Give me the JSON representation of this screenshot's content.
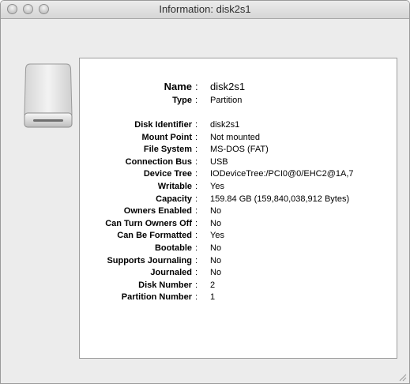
{
  "window": {
    "title": "Information: disk2s1"
  },
  "icons": {
    "drive": "external-drive-icon",
    "resize": "resize-grip-icon"
  },
  "info": {
    "name": {
      "label": "Name",
      "value": "disk2s1"
    },
    "type": {
      "label": "Type",
      "value": "Partition"
    },
    "properties": [
      {
        "label": "Disk Identifier",
        "value": "disk2s1"
      },
      {
        "label": "Mount Point",
        "value": "Not mounted"
      },
      {
        "label": "File System",
        "value": "MS-DOS (FAT)"
      },
      {
        "label": "Connection Bus",
        "value": "USB"
      },
      {
        "label": "Device Tree",
        "value": "IODeviceTree:/PCI0@0/EHC2@1A,7"
      },
      {
        "label": "Writable",
        "value": "Yes"
      },
      {
        "label": "Capacity",
        "value": "159.84 GB (159,840,038,912 Bytes)"
      },
      {
        "label": "Owners Enabled",
        "value": "No"
      },
      {
        "label": "Can Turn Owners Off",
        "value": "No"
      },
      {
        "label": "Can Be Formatted",
        "value": "Yes"
      },
      {
        "label": "Bootable",
        "value": "No"
      },
      {
        "label": "Supports Journaling",
        "value": "No"
      },
      {
        "label": "Journaled",
        "value": "No"
      },
      {
        "label": "Disk Number",
        "value": "2"
      },
      {
        "label": "Partition Number",
        "value": "1"
      }
    ]
  },
  "separator": ":"
}
